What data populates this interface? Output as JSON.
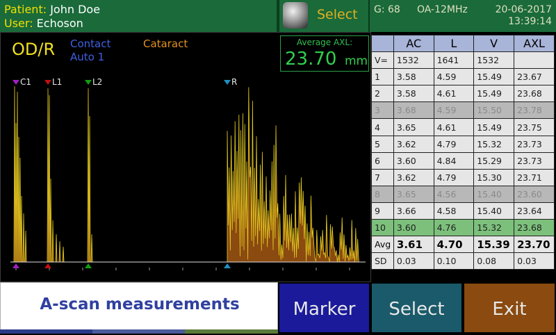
{
  "header": {
    "patient_label": "Patient:",
    "patient_name": "John Doe",
    "user_label": "User:",
    "user_name": "Echoson",
    "select_label": "Select",
    "gain": "G:  68",
    "probe": "OA-12MHz",
    "date": "20-06-2017",
    "time": "13:39:14"
  },
  "scan": {
    "eye": "OD/R",
    "mode_contact": "Contact",
    "mode_auto": "Auto 1",
    "mode_cataract": "Cataract",
    "axl_title": "Average AXL:",
    "axl_value": "23.70",
    "axl_unit": "mm",
    "markers": [
      {
        "label": "C1",
        "color": "#a020c0"
      },
      {
        "label": "L1",
        "color": "#c01010"
      },
      {
        "label": "L2",
        "color": "#10a010"
      },
      {
        "label": "R",
        "color": "#2090c0"
      }
    ]
  },
  "table": {
    "columns": [
      "AC",
      "L",
      "V",
      "AXL"
    ],
    "velocity": {
      "label": "V=",
      "values": [
        "1532",
        "1641",
        "1532",
        ""
      ]
    },
    "rows": [
      {
        "n": "1",
        "v": [
          "3.58",
          "4.59",
          "15.49",
          "23.67"
        ],
        "state": "normal"
      },
      {
        "n": "2",
        "v": [
          "3.58",
          "4.61",
          "15.49",
          "23.68"
        ],
        "state": "normal"
      },
      {
        "n": "3",
        "v": [
          "3.68",
          "4.59",
          "15.50",
          "23.78"
        ],
        "state": "reject"
      },
      {
        "n": "4",
        "v": [
          "3.65",
          "4.61",
          "15.49",
          "23.75"
        ],
        "state": "normal"
      },
      {
        "n": "5",
        "v": [
          "3.62",
          "4.79",
          "15.32",
          "23.73"
        ],
        "state": "normal"
      },
      {
        "n": "6",
        "v": [
          "3.60",
          "4.84",
          "15.29",
          "23.73"
        ],
        "state": "normal"
      },
      {
        "n": "7",
        "v": [
          "3.62",
          "4.79",
          "15.30",
          "23.71"
        ],
        "state": "normal"
      },
      {
        "n": "8",
        "v": [
          "3.65",
          "4.56",
          "15.40",
          "23.60"
        ],
        "state": "reject"
      },
      {
        "n": "9",
        "v": [
          "3.66",
          "4.58",
          "15.40",
          "23.64"
        ],
        "state": "normal"
      },
      {
        "n": "10",
        "v": [
          "3.60",
          "4.76",
          "15.32",
          "23.68"
        ],
        "state": "selected"
      }
    ],
    "avg": {
      "label": "Avg",
      "values": [
        "3.61",
        "4.70",
        "15.39",
        "23.70"
      ]
    },
    "sd": {
      "label": "SD",
      "values": [
        "0.03",
        "0.10",
        "0.08",
        "0.03"
      ]
    }
  },
  "bottom": {
    "title": "A-scan measurements",
    "marker_btn": "Marker",
    "select_btn": "Select",
    "exit_btn": "Exit"
  },
  "colors": {
    "waveform_fill": "#8a4a10",
    "waveform_line": "#e8d020"
  }
}
